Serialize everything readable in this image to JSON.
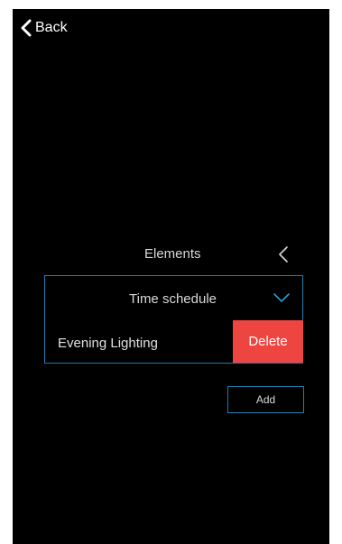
{
  "nav": {
    "back_label": "Back",
    "back_icon": "chevron-left-icon"
  },
  "elements": {
    "title": "Elements",
    "toggle_icon": "chevron-left-icon"
  },
  "schedule": {
    "label": "Time schedule",
    "expand_icon": "chevron-down-icon"
  },
  "items": [
    {
      "label": "Evening Lighting",
      "delete_label": "Delete"
    }
  ],
  "actions": {
    "add_label": "Add"
  },
  "colors": {
    "background": "#000000",
    "accent_border": "#1e7fb0",
    "delete_bg": "#ee4540",
    "text": "#d8d8d8"
  }
}
